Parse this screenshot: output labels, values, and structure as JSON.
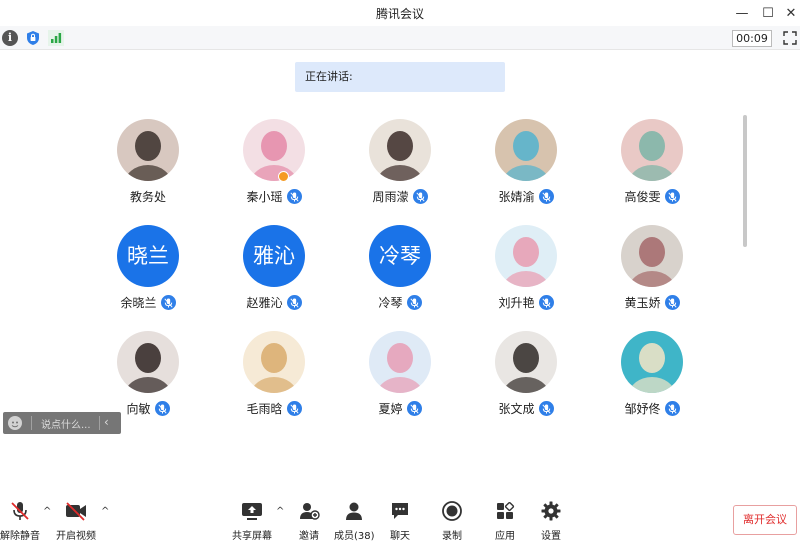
{
  "window": {
    "title": "腾讯会议",
    "minimize": "—",
    "maximize": "☐",
    "close": "✕"
  },
  "infobar": {
    "info_glyph": "i",
    "timer": "00:09"
  },
  "speaking": {
    "label": "正在讲话:"
  },
  "participants": [
    {
      "name": "教务处",
      "avatar_type": "photo",
      "muted": false,
      "photo_colors": [
        "#d8c8c0",
        "#3a2f2a"
      ]
    },
    {
      "name": "秦小瑶",
      "avatar_type": "photo",
      "muted": true,
      "host": true,
      "photo_colors": [
        "#f3dfe4",
        "#e48aa8"
      ]
    },
    {
      "name": "周雨濛",
      "avatar_type": "photo",
      "muted": true,
      "photo_colors": [
        "#e9e2da",
        "#3b2b28"
      ]
    },
    {
      "name": "张婧渝",
      "avatar_type": "photo",
      "muted": true,
      "photo_colors": [
        "#d7c3ae",
        "#52b3cf"
      ]
    },
    {
      "name": "高俊雯",
      "avatar_type": "photo",
      "muted": true,
      "photo_colors": [
        "#e9c9c6",
        "#7bb5a7"
      ]
    },
    {
      "name": "余晓兰",
      "avatar_type": "text",
      "avatar_text": "晓兰",
      "muted": true
    },
    {
      "name": "赵雅沁",
      "avatar_type": "text",
      "avatar_text": "雅沁",
      "muted": true
    },
    {
      "name": "冷琴",
      "avatar_type": "text",
      "avatar_text": "冷琴",
      "muted": true
    },
    {
      "name": "刘升艳",
      "avatar_type": "photo",
      "muted": true,
      "photo_colors": [
        "#dfeef6",
        "#e99bb0"
      ]
    },
    {
      "name": "黄玉娇",
      "avatar_type": "photo",
      "muted": true,
      "photo_colors": [
        "#d8d2cc",
        "#a5696a"
      ]
    },
    {
      "name": "向敏",
      "avatar_type": "photo",
      "muted": true,
      "photo_colors": [
        "#e6dfdc",
        "#2e2422"
      ]
    },
    {
      "name": "毛雨晗",
      "avatar_type": "photo",
      "muted": true,
      "photo_colors": [
        "#f6ead6",
        "#d9ab6c"
      ]
    },
    {
      "name": "夏婷",
      "avatar_type": "photo",
      "muted": true,
      "photo_colors": [
        "#dfeaf6",
        "#e89db5"
      ]
    },
    {
      "name": "张文成",
      "avatar_type": "photo",
      "muted": true,
      "photo_colors": [
        "#e9e6e3",
        "#2f2927"
      ]
    },
    {
      "name": "邹妤佟",
      "avatar_type": "photo",
      "muted": true,
      "photo_colors": [
        "#3fb5c8",
        "#f4e5c5"
      ]
    }
  ],
  "chat": {
    "placeholder": "说点什么...",
    "collapse_glyph": "‹"
  },
  "toolbar": {
    "unmute": "解除静音",
    "start_video": "开启视频",
    "share_screen": "共享屏幕",
    "invite": "邀请",
    "members": "成员(38)",
    "chat": "聊天",
    "record": "录制",
    "apps": "应用",
    "settings": "设置",
    "leave": "离开会议",
    "caret": "^"
  },
  "colors": {
    "accent": "#1a73e8",
    "leave": "#e02b2b",
    "speaking_bg": "#dde9fb"
  }
}
